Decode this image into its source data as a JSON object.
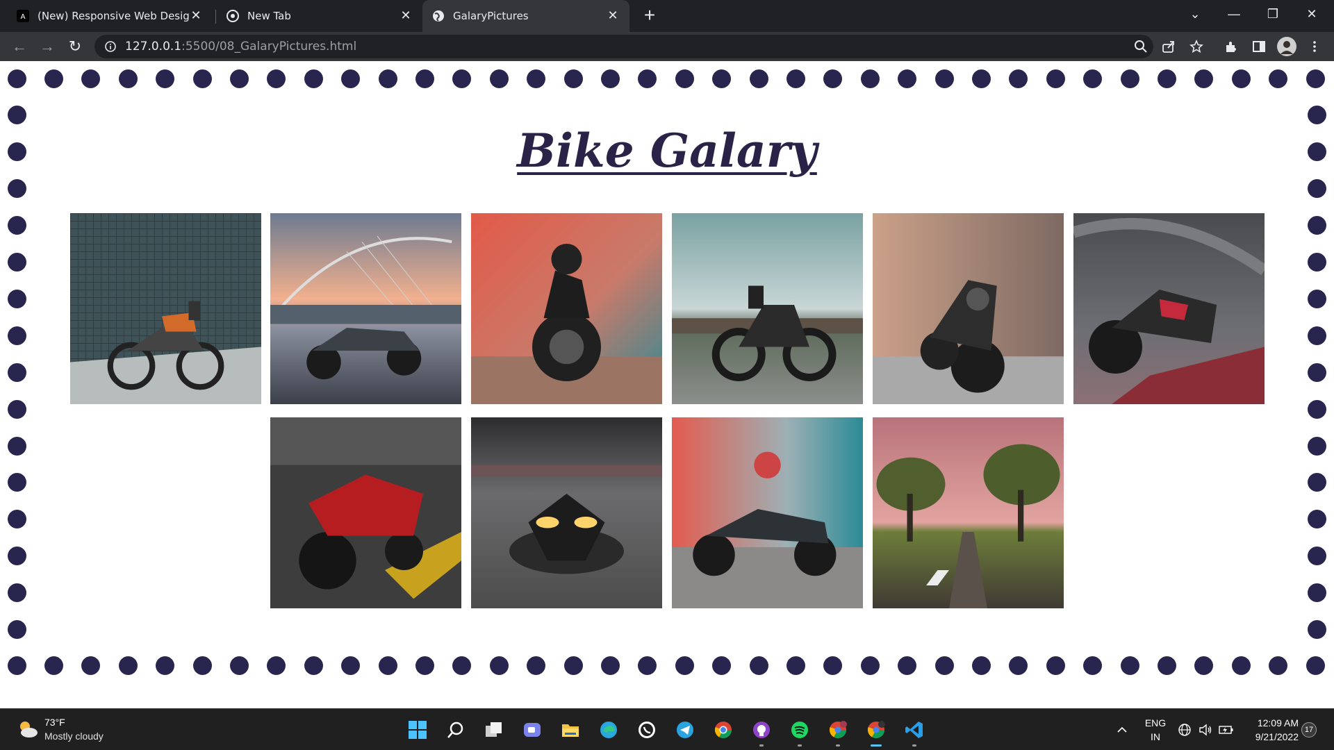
{
  "browser": {
    "tabs": [
      {
        "title": "(New) Responsive Web Design C",
        "favicon": "angular-icon"
      },
      {
        "title": "New Tab",
        "favicon": "chrome-icon"
      },
      {
        "title": "GalaryPictures",
        "favicon": "globe-icon",
        "active": true
      }
    ],
    "url_host": "127.0.0.1",
    "url_path": ":5500/08_GalaryPictures.html"
  },
  "page": {
    "title": "Bike Galary",
    "accent_color": "#28254f",
    "title_color": "#2b2247",
    "gallery": [
      {
        "name": "electric-bike-tiled-wall"
      },
      {
        "name": "bike-cable-bridge"
      },
      {
        "name": "rider-red-smoke"
      },
      {
        "name": "naked-bike-field"
      },
      {
        "name": "naked-bike-street"
      },
      {
        "name": "sportbike-overpass"
      },
      {
        "name": "red-bike-garage"
      },
      {
        "name": "bike-headlights"
      },
      {
        "name": "rider-smoke-flare"
      },
      {
        "name": "tree-road"
      }
    ]
  },
  "taskbar": {
    "weather_temp": "73°F",
    "weather_condition": "Mostly cloudy",
    "language": "ENG",
    "region": "IN",
    "time": "12:09 AM",
    "date": "9/21/2022",
    "notification_count": "17",
    "apps": [
      "start",
      "search",
      "task-view",
      "teams-chat",
      "file-explorer",
      "edge",
      "whatsapp",
      "telegram",
      "chrome",
      "github-desktop",
      "spotify",
      "chrome-profile",
      "chrome",
      "vscode"
    ]
  }
}
